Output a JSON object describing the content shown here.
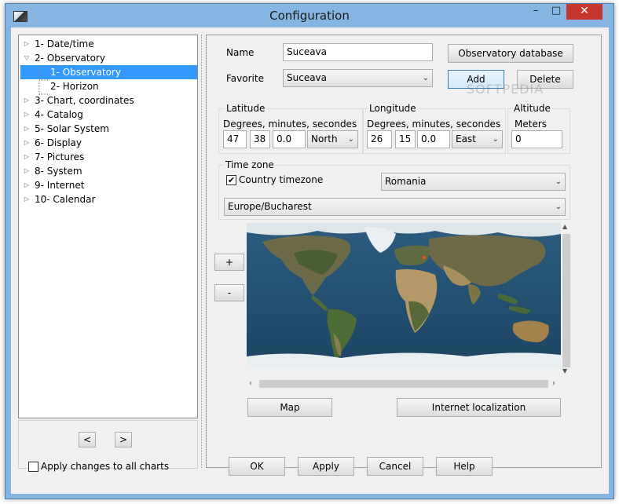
{
  "window": {
    "title": "Configuration",
    "minimize": "–",
    "maximize": "□",
    "close": "✕"
  },
  "tree": {
    "items": [
      {
        "label": "1- Date/time",
        "expander": "▷"
      },
      {
        "label": "2- Observatory",
        "expander": "▽"
      },
      {
        "label": "1- Observatory",
        "expander": ""
      },
      {
        "label": "2- Horizon",
        "expander": ""
      },
      {
        "label": "3- Chart, coordinates",
        "expander": "▷"
      },
      {
        "label": "4- Catalog",
        "expander": "▷"
      },
      {
        "label": "5- Solar System",
        "expander": "▷"
      },
      {
        "label": "6- Display",
        "expander": "▷"
      },
      {
        "label": "7- Pictures",
        "expander": "▷"
      },
      {
        "label": "8- System",
        "expander": "▷"
      },
      {
        "label": "9- Internet",
        "expander": "▷"
      },
      {
        "label": "10- Calendar",
        "expander": "▷"
      }
    ],
    "prev_label": "<",
    "next_label": ">"
  },
  "observatory": {
    "name_label": "Name",
    "name_value": "Suceava",
    "db_button": "Observatory database",
    "favorite_label": "Favorite",
    "favorite_value": "Suceava",
    "add_button": "Add",
    "delete_button": "Delete"
  },
  "latitude": {
    "title": "Latitude",
    "sub": "Degrees, minutes, secondes",
    "deg": "47",
    "min": "38",
    "sec": "0.0",
    "hemi": "North"
  },
  "longitude": {
    "title": "Longitude",
    "sub": "Degrees, minutes, secondes",
    "deg": "26",
    "min": "15",
    "sec": "0.0",
    "hemi": "East"
  },
  "altitude": {
    "title": "Altitude",
    "sub": "Meters",
    "value": "0"
  },
  "timezone": {
    "title": "Time zone",
    "country_tz_label": "Country timezone",
    "country_tz_checked": "✔",
    "country": "Romania",
    "zone": "Europe/Bucharest"
  },
  "map": {
    "zoom_in": "+",
    "zoom_out": "-",
    "map_button": "Map",
    "internet_button": "Internet localization",
    "watermark": "SOFTPEDIA"
  },
  "bottom": {
    "apply_all_label": "Apply changes to all charts",
    "ok": "OK",
    "apply": "Apply",
    "cancel": "Cancel",
    "help": "Help"
  }
}
